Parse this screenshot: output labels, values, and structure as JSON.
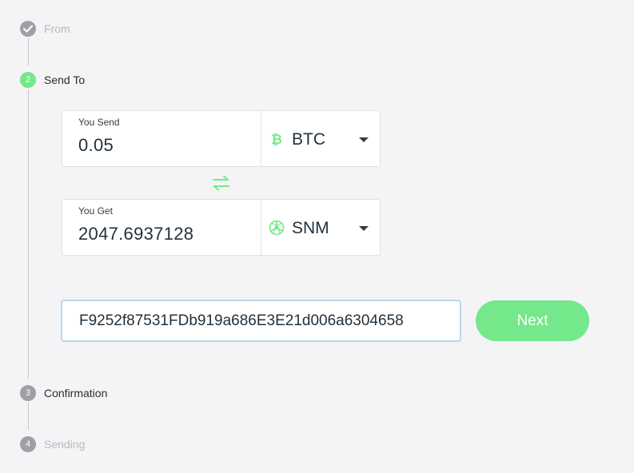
{
  "steps": [
    {
      "number": "✓",
      "label": "From"
    },
    {
      "number": "2",
      "label": "Send To"
    },
    {
      "number": "3",
      "label": "Confirmation"
    },
    {
      "number": "4",
      "label": "Sending"
    }
  ],
  "send": {
    "caption": "You Send",
    "amount": "0.05",
    "currency": "BTC",
    "icon": "bitcoin-icon"
  },
  "swap_icon": "swap-arrows-icon",
  "get": {
    "caption": "You Get",
    "amount": "2047.6937128",
    "currency": "SNM",
    "icon": "sonm-icon"
  },
  "address": {
    "value": "F9252f87531FDb919a686E3E21d006a6304658"
  },
  "next_button": {
    "label": "Next"
  },
  "colors": {
    "accent": "#74e88a",
    "completed": "#a0a0a4",
    "inactive": "#a0a0a4",
    "input_focus": "#b7d7ef"
  }
}
